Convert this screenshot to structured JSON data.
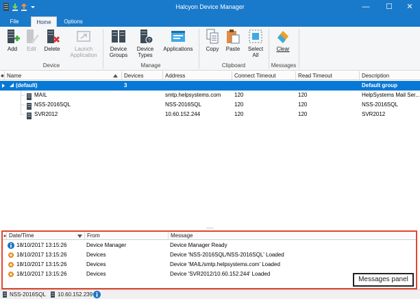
{
  "window": {
    "title": "Halcyon Device Manager"
  },
  "ribbon": {
    "tabs": [
      {
        "label": "File"
      },
      {
        "label": "Home"
      },
      {
        "label": "Options"
      }
    ],
    "buttons": {
      "add": "Add",
      "edit": "Edit",
      "delete": "Delete",
      "launch_line1": "Launch",
      "launch_line2": "Application",
      "device_groups_line1": "Device",
      "device_groups_line2": "Groups",
      "device_types_line1": "Device",
      "device_types_line2": "Types",
      "applications": "Applications",
      "copy": "Copy",
      "paste": "Paste",
      "select_all_line1": "Select",
      "select_all_line2": "All",
      "clear": "Clear"
    },
    "groups": {
      "device": "Device",
      "manage": "Manage",
      "clipboard": "Clipboard",
      "messages": "Messages"
    }
  },
  "grid": {
    "columns": [
      "Name",
      "Devices",
      "Address",
      "Connect Timeout",
      "Read Timeout",
      "Description"
    ],
    "group_row": {
      "name": "(default)",
      "devices": "3",
      "description": "Default group"
    },
    "rows": [
      {
        "name": "MAIL",
        "address": "smtp.helpsystems.com",
        "connect": "120",
        "read": "120",
        "description": "HelpSystems Mail Ser..."
      },
      {
        "name": "NSS-2016SQL",
        "address": "NSS-2016SQL",
        "connect": "120",
        "read": "120",
        "description": "NSS-2016SQL"
      },
      {
        "name": "SVR2012",
        "address": "10.60.152.244",
        "connect": "120",
        "read": "120",
        "description": "SVR2012"
      }
    ]
  },
  "splitter": {
    "grip": "....."
  },
  "messages": {
    "columns": [
      "Date/Time",
      "From",
      "Message"
    ],
    "rows": [
      {
        "icon": "info-icon",
        "datetime": "18/10/2017 13:15:26",
        "from": "Device Manager",
        "message": "Device Manager Ready"
      },
      {
        "icon": "gear-icon",
        "datetime": "18/10/2017 13:15:26",
        "from": "Devices",
        "message": "Device 'NSS-2016SQL/NSS-2016SQL' Loaded"
      },
      {
        "icon": "gear-icon",
        "datetime": "18/10/2017 13:15:26",
        "from": "Devices",
        "message": "Device 'MAIL/smtp.helpsystems.com' Loaded"
      },
      {
        "icon": "gear-icon",
        "datetime": "18/10/2017 13:15:26",
        "from": "Devices",
        "message": "Device 'SVR2012/10.60.152.244' Loaded"
      }
    ],
    "callout": "Messages panel"
  },
  "statusbar": {
    "device": "NSS-2016SQL",
    "address": "10.60.152.239"
  },
  "colors": {
    "titlebar": "#1979ca",
    "selection": "#0878d7",
    "messages_border": "#e2442e"
  }
}
